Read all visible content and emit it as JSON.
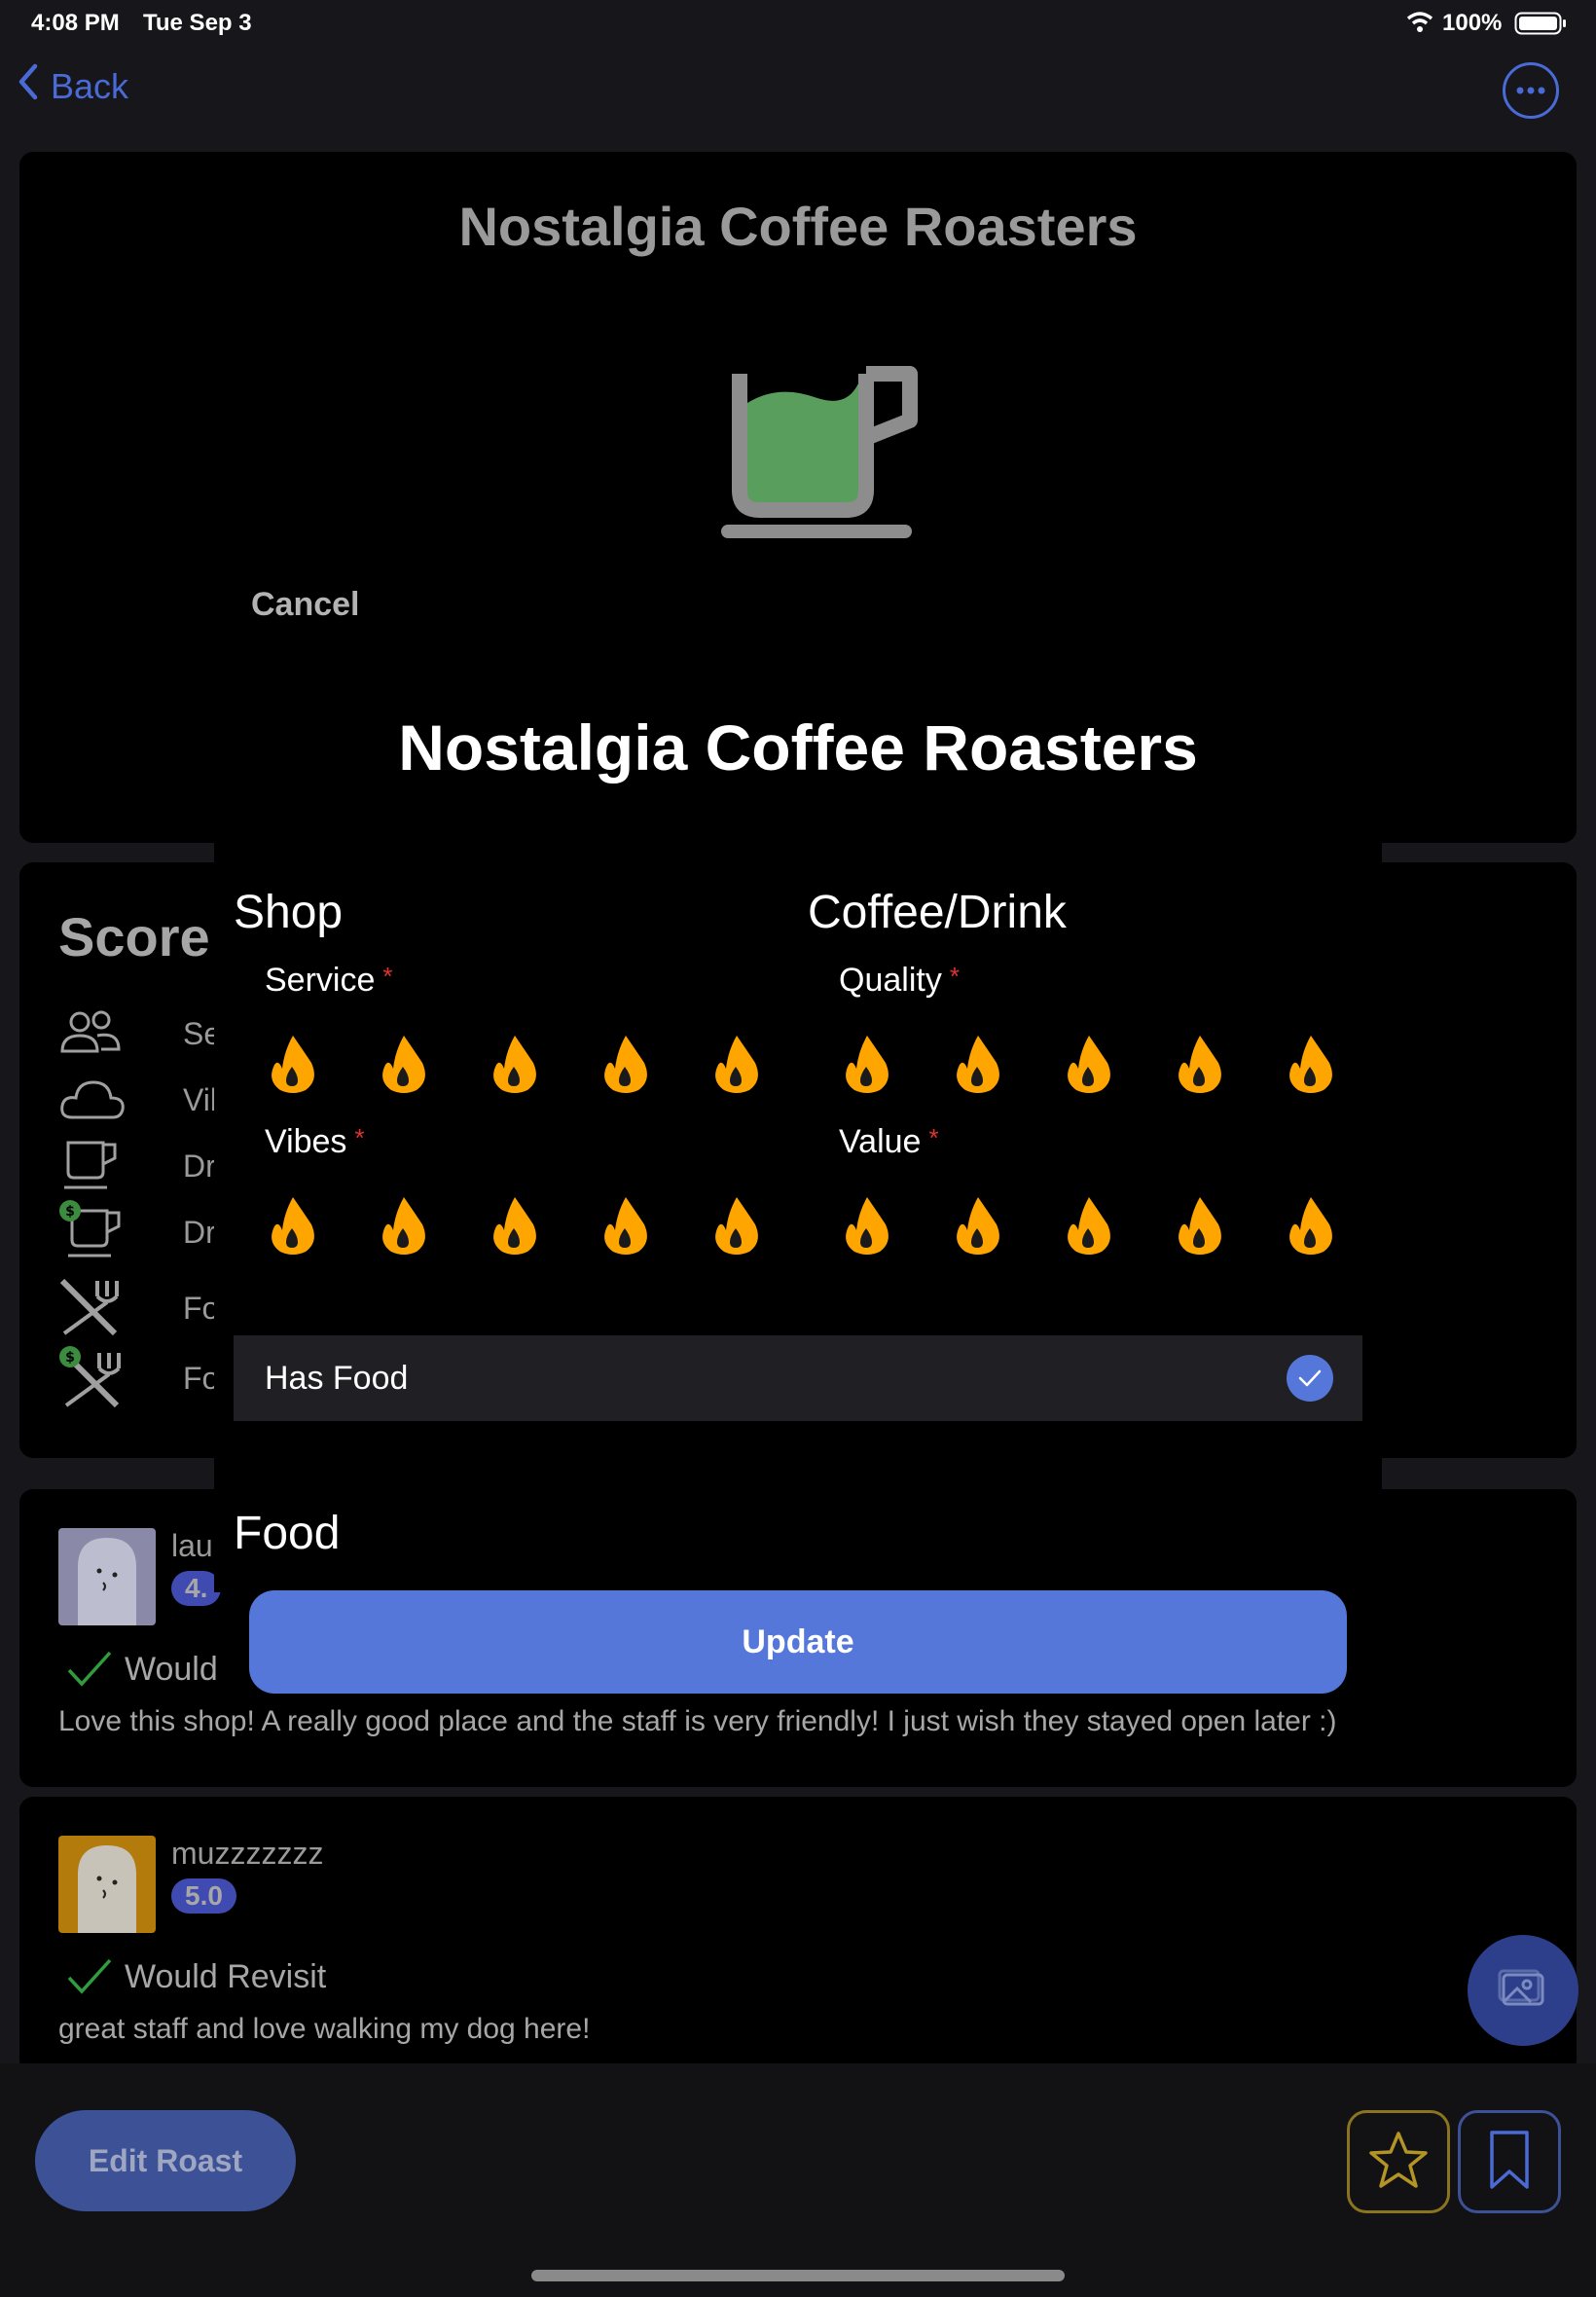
{
  "status_bar": {
    "time": "4:08 PM",
    "date": "Tue Sep 3",
    "battery": "100%"
  },
  "nav": {
    "back_label": "Back"
  },
  "shop": {
    "title": "Nostalgia Coffee Roasters"
  },
  "score": {
    "title": "Score",
    "rows": [
      {
        "icon": "people-icon",
        "label": "Ser"
      },
      {
        "icon": "cloud-icon",
        "label": "Vib"
      },
      {
        "icon": "cup-icon",
        "label": "Drir"
      },
      {
        "icon": "cup-dollar-icon",
        "label": "Drir"
      },
      {
        "icon": "utensils-icon",
        "label": "Foc"
      },
      {
        "icon": "utensils-dollar-icon",
        "label": "Foc"
      }
    ]
  },
  "reviews": [
    {
      "name": "lau",
      "rating": "4.",
      "revisit": "Would",
      "text": "Love this shop! A really good place and the staff is very friendly! I just wish they stayed open later :)"
    },
    {
      "name": "muzzzzzzz",
      "rating": "5.0",
      "revisit": "Would Revisit",
      "text": "great staff and love walking my dog here!"
    }
  ],
  "bottom": {
    "edit_label": "Edit Roast"
  },
  "modal": {
    "cancel_label": "Cancel",
    "title": "Nostalgia Coffee Roasters",
    "sections": {
      "shop_heading": "Shop",
      "drink_heading": "Coffee/Drink",
      "food_heading": "Food"
    },
    "fields": {
      "service": {
        "label": "Service",
        "required": "*",
        "rating": 5
      },
      "vibes": {
        "label": "Vibes",
        "required": "*",
        "rating": 5
      },
      "quality": {
        "label": "Quality",
        "required": "*",
        "rating": 5
      },
      "value": {
        "label": "Value",
        "required": "*",
        "rating": 5
      }
    },
    "has_food": {
      "label": "Has Food",
      "checked": true
    },
    "update_label": "Update"
  },
  "colors": {
    "accent": "#5577d9",
    "flame": "#ffa500",
    "required": "#e0322f",
    "cup_fill": "#5a9e5e"
  }
}
